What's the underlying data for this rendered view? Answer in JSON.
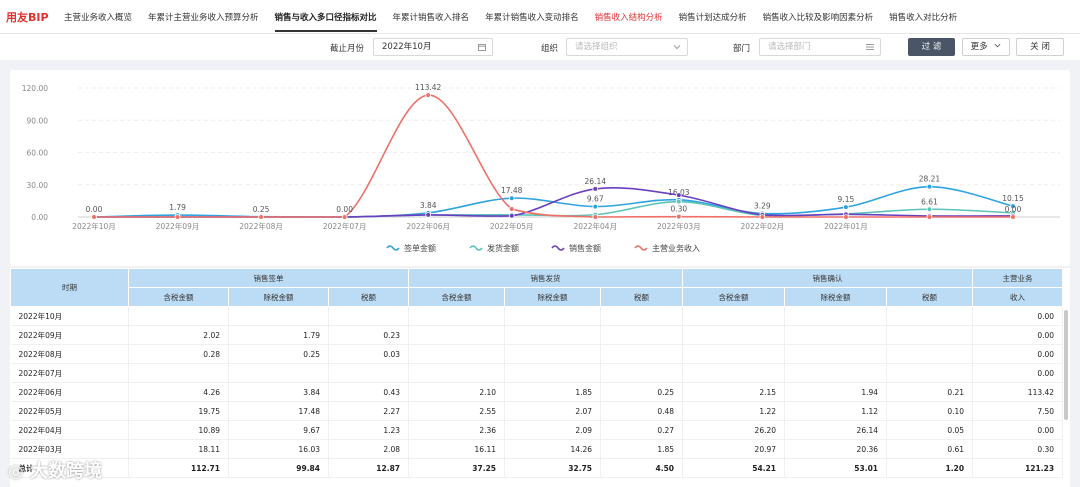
{
  "brand": "用友BIP",
  "tabs": [
    {
      "label": "主营业务收入概览",
      "state": "normal"
    },
    {
      "label": "年累计主营业务收入预算分析",
      "state": "normal"
    },
    {
      "label": "销售与收入多口径指标对比",
      "state": "active"
    },
    {
      "label": "年累计销售收入排名",
      "state": "normal"
    },
    {
      "label": "年累计销售收入变动排名",
      "state": "normal"
    },
    {
      "label": "销售收入结构分析",
      "state": "red"
    },
    {
      "label": "销售计划达成分析",
      "state": "normal"
    },
    {
      "label": "销售收入比较及影响因素分析",
      "state": "normal"
    },
    {
      "label": "销售收入对比分析",
      "state": "normal"
    }
  ],
  "filters": {
    "month_label": "截止月份",
    "month_value": "2022年10月",
    "org_label": "组织",
    "org_placeholder": "请选择组织",
    "dept_label": "部门",
    "dept_placeholder": "请选择部门",
    "filter_button": "过 滤",
    "more_button": "更多",
    "close_button": "关 闭"
  },
  "icons": {
    "calendar": "calendar-icon",
    "dropdown": "chevron-down-icon",
    "list": "list-icon"
  },
  "chart_data": {
    "type": "line",
    "categories": [
      "2022年10月",
      "2022年09月",
      "2022年08月",
      "2022年07月",
      "2022年06月",
      "2022年05月",
      "2022年04月",
      "2022年03月",
      "2022年02月",
      "2022年01月"
    ],
    "ylim": [
      0,
      120
    ],
    "yticks": [
      "0.00",
      "30.00",
      "60.00",
      "90.00",
      "120.00"
    ],
    "grid": true,
    "legend_position": "bottom",
    "series": [
      {
        "name": "签单金额",
        "color": "#2fa3e0",
        "values": [
          0,
          1.79,
          0.25,
          0,
          3.84,
          17.48,
          9.67,
          16.03,
          3.29,
          9.15,
          28.21,
          10.15
        ],
        "labels": [
          "",
          "1.79",
          "",
          "",
          "3.84",
          "17.48",
          "9.67",
          "16.03",
          "3.29",
          "9.15",
          "28.21",
          "10.15"
        ]
      },
      {
        "name": "发货金额",
        "color": "#5cc3b8",
        "values": [
          0,
          0,
          0,
          0,
          1.85,
          2.07,
          2.09,
          14.26,
          1.5,
          3,
          7.2,
          3.8
        ],
        "labels": [
          "",
          "",
          "",
          "",
          "",
          "",
          "",
          "",
          "",
          "",
          "6.61",
          ""
        ]
      },
      {
        "name": "销售金额",
        "color": "#6a3fbf",
        "values": [
          0,
          0,
          0,
          0,
          1.94,
          1.12,
          26.14,
          20.36,
          2,
          2.5,
          1,
          1
        ],
        "labels": [
          "",
          "",
          "",
          "",
          "",
          "",
          "26.14",
          "",
          "",
          "",
          "",
          ""
        ]
      },
      {
        "name": "主营业务收入",
        "color": "#f07068",
        "values": [
          0,
          0,
          0,
          0,
          113.42,
          7.5,
          0,
          0.3,
          0,
          0,
          0,
          0
        ],
        "labels": [
          "0.00",
          "",
          "0.25",
          "0.00",
          "113.42",
          "",
          "",
          "0.30",
          "",
          "",
          "",
          "0.00"
        ]
      }
    ]
  },
  "table": {
    "col_time": "时期",
    "groups": [
      "销售签单",
      "销售发货",
      "销售确认",
      "主营业务"
    ],
    "subheaders": [
      "含税金额",
      "除税金额",
      "税额",
      "含税金额",
      "除税金额",
      "税额",
      "含税金额",
      "除税金额",
      "税额",
      "收入"
    ],
    "rows": [
      [
        "2022年10月",
        "",
        "",
        "",
        "",
        "",
        "",
        "",
        "",
        "",
        "0.00"
      ],
      [
        "2022年09月",
        "2.02",
        "1.79",
        "0.23",
        "",
        "",
        "",
        "",
        "",
        "",
        "0.00"
      ],
      [
        "2022年08月",
        "0.28",
        "0.25",
        "0.03",
        "",
        "",
        "",
        "",
        "",
        "",
        "0.00"
      ],
      [
        "2022年07月",
        "",
        "",
        "",
        "",
        "",
        "",
        "",
        "",
        "",
        "0.00"
      ],
      [
        "2022年06月",
        "4.26",
        "3.84",
        "0.43",
        "2.10",
        "1.85",
        "0.25",
        "2.15",
        "1.94",
        "0.21",
        "113.42"
      ],
      [
        "2022年05月",
        "19.75",
        "17.48",
        "2.27",
        "2.55",
        "2.07",
        "0.48",
        "1.22",
        "1.12",
        "0.10",
        "7.50"
      ],
      [
        "2022年04月",
        "10.89",
        "9.67",
        "1.23",
        "2.36",
        "2.09",
        "0.27",
        "26.20",
        "26.14",
        "0.05",
        "0.00"
      ],
      [
        "2022年03月",
        "18.11",
        "16.03",
        "2.08",
        "16.11",
        "14.26",
        "1.85",
        "20.97",
        "20.36",
        "0.61",
        "0.30"
      ]
    ],
    "total": [
      "总计",
      "112.71",
      "99.84",
      "12.87",
      "37.25",
      "32.75",
      "4.50",
      "54.21",
      "53.01",
      "1.20",
      "121.23"
    ]
  },
  "watermark": "大数跨境"
}
